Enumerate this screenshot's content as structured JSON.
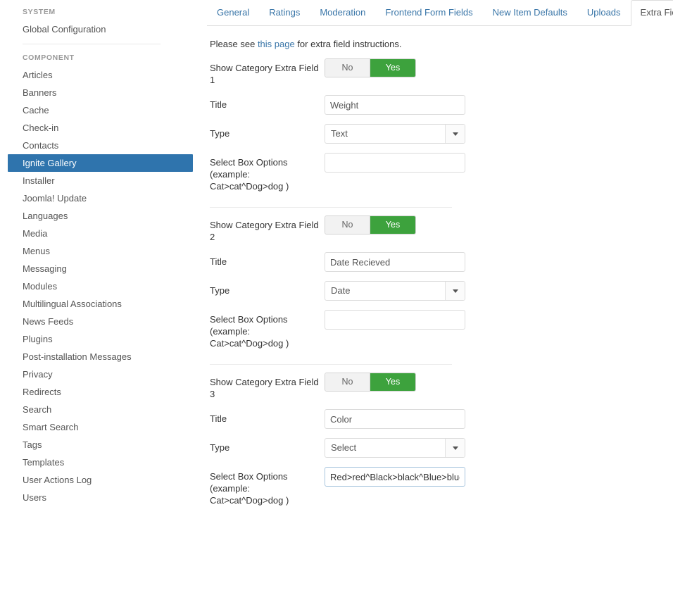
{
  "sidebar": {
    "groups": [
      {
        "heading": "SYSTEM",
        "items": [
          {
            "label": "Global Configuration",
            "active": false
          }
        ]
      },
      {
        "heading": "COMPONENT",
        "items": [
          {
            "label": "Articles",
            "active": false
          },
          {
            "label": "Banners",
            "active": false
          },
          {
            "label": "Cache",
            "active": false
          },
          {
            "label": "Check-in",
            "active": false
          },
          {
            "label": "Contacts",
            "active": false
          },
          {
            "label": "Ignite Gallery",
            "active": true
          },
          {
            "label": "Installer",
            "active": false
          },
          {
            "label": "Joomla! Update",
            "active": false
          },
          {
            "label": "Languages",
            "active": false
          },
          {
            "label": "Media",
            "active": false
          },
          {
            "label": "Menus",
            "active": false
          },
          {
            "label": "Messaging",
            "active": false
          },
          {
            "label": "Modules",
            "active": false
          },
          {
            "label": "Multilingual Associations",
            "active": false
          },
          {
            "label": "News Feeds",
            "active": false
          },
          {
            "label": "Plugins",
            "active": false
          },
          {
            "label": "Post-installation Messages",
            "active": false
          },
          {
            "label": "Privacy",
            "active": false
          },
          {
            "label": "Redirects",
            "active": false
          },
          {
            "label": "Search",
            "active": false
          },
          {
            "label": "Smart Search",
            "active": false
          },
          {
            "label": "Tags",
            "active": false
          },
          {
            "label": "Templates",
            "active": false
          },
          {
            "label": "User Actions Log",
            "active": false
          },
          {
            "label": "Users",
            "active": false
          }
        ]
      }
    ]
  },
  "tabs": [
    {
      "label": "General",
      "active": false
    },
    {
      "label": "Ratings",
      "active": false
    },
    {
      "label": "Moderation",
      "active": false
    },
    {
      "label": "Frontend Form Fields",
      "active": false
    },
    {
      "label": "New Item Defaults",
      "active": false
    },
    {
      "label": "Uploads",
      "active": false
    },
    {
      "label": "Extra Fields",
      "active": true
    }
  ],
  "intro": {
    "before": "Please see ",
    "link": "this page",
    "after": " for extra field instructions."
  },
  "labels": {
    "title": "Title",
    "type": "Type",
    "select_box_options": "Select Box Options (example: Cat>cat^Dog>dog )"
  },
  "toggle": {
    "no_label": "No",
    "yes_label": "Yes"
  },
  "fields": [
    {
      "show_label": "Show Category Extra Field 1",
      "show_value": "Yes",
      "title_value": "Weight",
      "type_value": "Text",
      "options_value": "",
      "options_focused": false
    },
    {
      "show_label": "Show Category Extra Field 2",
      "show_value": "Yes",
      "title_value": "Date Recieved",
      "type_value": "Date",
      "options_value": "",
      "options_focused": false
    },
    {
      "show_label": "Show Category Extra Field 3",
      "show_value": "Yes",
      "title_value": "Color",
      "type_value": "Select",
      "options_value": "Red>red^Black>black^Blue>blue",
      "options_focused": true
    }
  ],
  "colors": {
    "accent_blue": "#2f74ad",
    "link_blue": "#3a76a8",
    "toggle_on_green": "#3da23d",
    "focus_border": "#a9c6de",
    "border_gray": "#dcdcdc"
  }
}
